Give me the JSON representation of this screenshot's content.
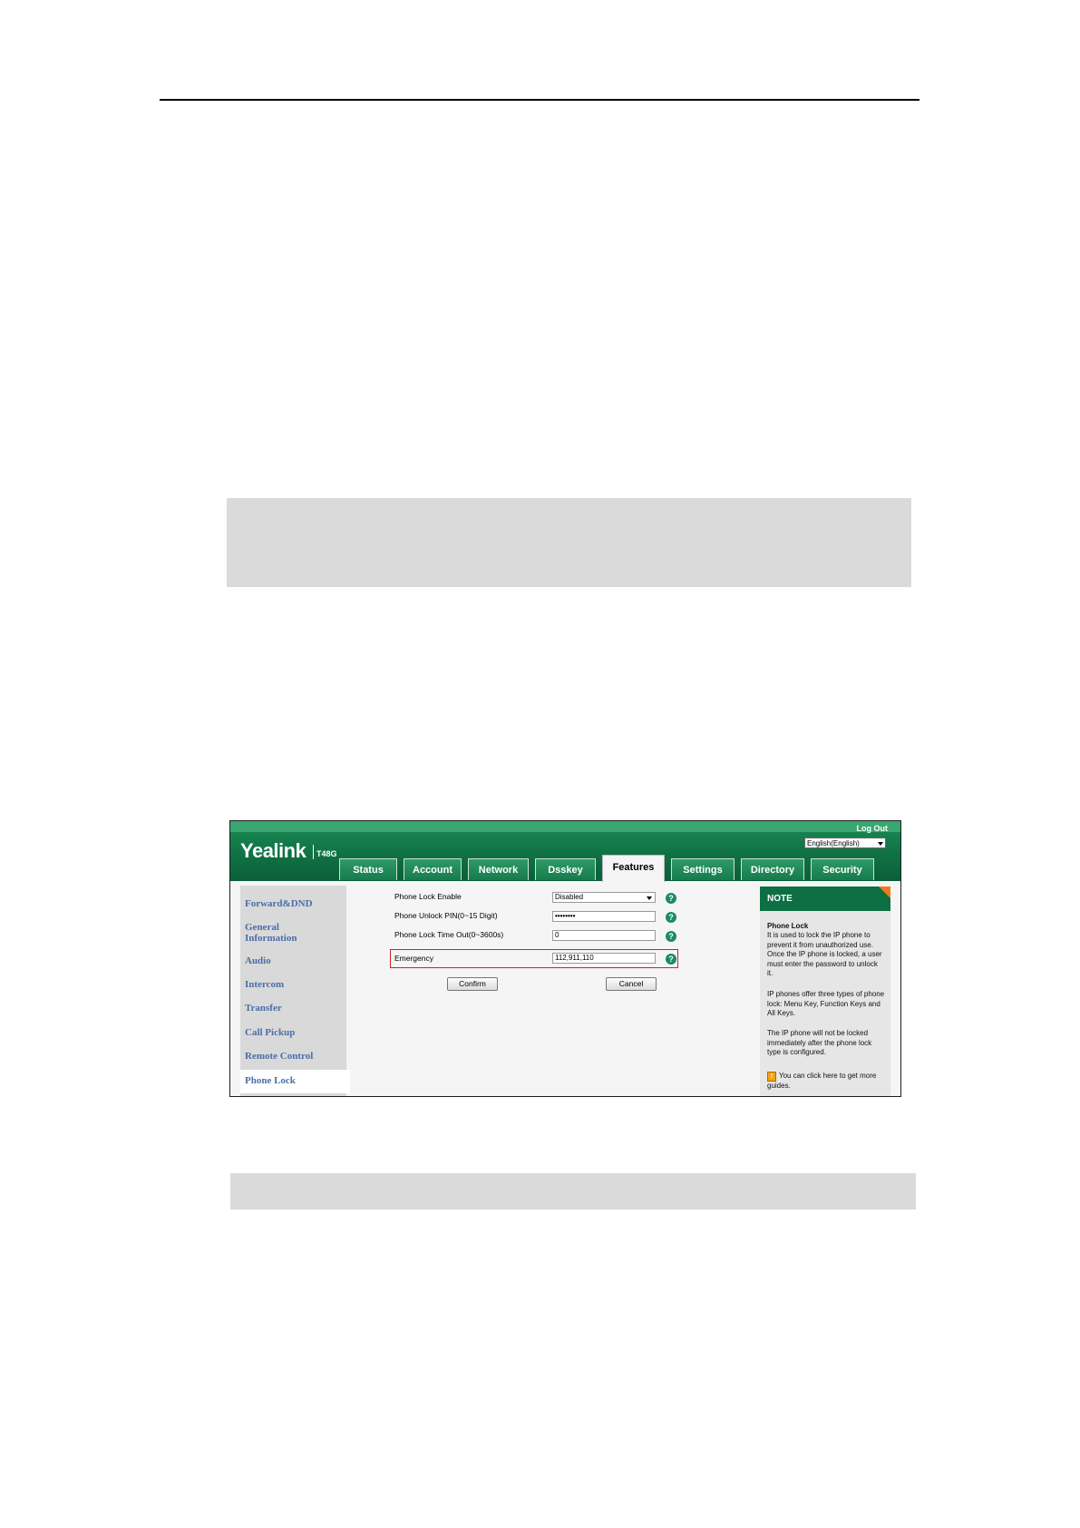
{
  "app": {
    "brand": "Yealink",
    "model": "T48G",
    "logout_label": "Log Out",
    "language": "English(English)"
  },
  "tabs": [
    {
      "label": "Status",
      "active": false
    },
    {
      "label": "Account",
      "active": false
    },
    {
      "label": "Network",
      "active": false
    },
    {
      "label": "Dsskey",
      "active": false
    },
    {
      "label": "Features",
      "active": true
    },
    {
      "label": "Settings",
      "active": false
    },
    {
      "label": "Directory",
      "active": false
    },
    {
      "label": "Security",
      "active": false
    }
  ],
  "sidebar": {
    "items": [
      {
        "label": "Forward&DND"
      },
      {
        "label": "General Information"
      },
      {
        "label": "Audio"
      },
      {
        "label": "Intercom"
      },
      {
        "label": "Transfer"
      },
      {
        "label": "Call Pickup"
      },
      {
        "label": "Remote Control"
      },
      {
        "label": "Phone Lock",
        "active": true
      }
    ]
  },
  "form": {
    "phone_lock_enable": {
      "label": "Phone Lock Enable",
      "value": "Disabled"
    },
    "unlock_pin": {
      "label": "Phone Unlock PIN(0~15 Digit)",
      "value": "••••••••"
    },
    "lock_timeout": {
      "label": "Phone Lock Time Out(0~3600s)",
      "value": "0"
    },
    "emergency": {
      "label": "Emergency",
      "value": "112,911,110"
    },
    "confirm_label": "Confirm",
    "cancel_label": "Cancel",
    "help_glyph": "?"
  },
  "note": {
    "header": "NOTE",
    "title": "Phone Lock",
    "p1": "It is used to lock the IP phone to prevent it from unauthorized use. Once the IP phone is locked, a user must enter the password to unlock it.",
    "p2": "IP phones offer three types of phone lock: Menu Key, Function Keys and All Keys.",
    "p3": "The IP phone will not be locked immediately after the phone lock type is configured.",
    "guide_icon": "!",
    "guide": "You can click here to get more guides."
  },
  "colors": {
    "brand_green": "#0f7043",
    "sidebar_link": "#4a6ea8",
    "highlight": "#d0202a",
    "note_corner": "#f07c18"
  }
}
